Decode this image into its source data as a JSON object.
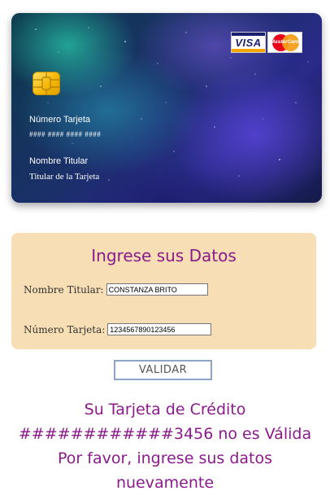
{
  "card": {
    "brand_logos": [
      "VISA",
      "MasterCard"
    ],
    "number_label": "Número Tarjeta",
    "number_placeholder": "#### #### #### ####",
    "holder_label": "Nombre Titular",
    "holder_placeholder": "Titular de la Tarjeta",
    "icons": [
      "chip-icon",
      "visa-logo-icon",
      "mastercard-logo-icon"
    ]
  },
  "form": {
    "title": "Ingrese sus Datos",
    "holder_label": "Nombre Titular:",
    "holder_value": "CONSTANZA BRITO",
    "number_label": "Número Tarjeta:",
    "number_value": "1234567890123456"
  },
  "validate_button": "VALIDAR",
  "result": {
    "line1": "Su Tarjeta de Crédito",
    "line2": "############3456 no es Válida",
    "line3": "Por favor, ingrese sus datos",
    "line4": "nuevamente"
  },
  "colors": {
    "accent": "#8b1a8b",
    "form_background": "#f7deb4"
  }
}
